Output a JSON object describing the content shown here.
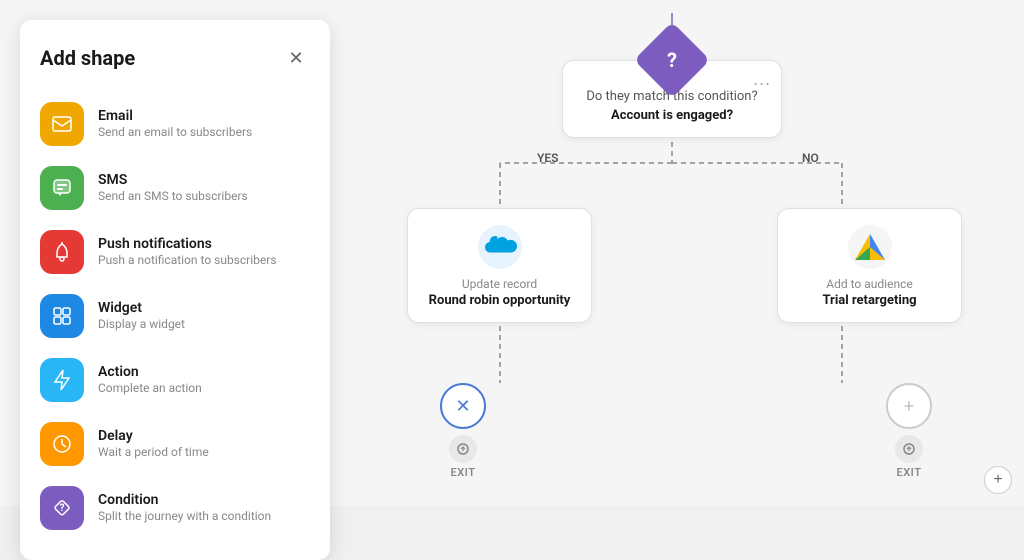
{
  "sidebar": {
    "title": "Add shape",
    "items": [
      {
        "id": "email",
        "name": "Email",
        "desc": "Send an email to subscribers",
        "icon_bg": "#f0a800",
        "icon_symbol": "✉"
      },
      {
        "id": "sms",
        "name": "SMS",
        "desc": "Send an SMS to subscribers",
        "icon_bg": "#4caf50",
        "icon_symbol": "💬"
      },
      {
        "id": "push",
        "name": "Push notifications",
        "desc": "Push a notification to subscribers",
        "icon_bg": "#e53935",
        "icon_symbol": "🔔"
      },
      {
        "id": "widget",
        "name": "Widget",
        "desc": "Display a widget",
        "icon_bg": "#1e88e5",
        "icon_symbol": "⬛"
      },
      {
        "id": "action",
        "name": "Action",
        "desc": "Complete an action",
        "icon_bg": "#29b6f6",
        "icon_symbol": "⚡"
      },
      {
        "id": "delay",
        "name": "Delay",
        "desc": "Wait a period of time",
        "icon_bg": "#ff9800",
        "icon_symbol": "⏱"
      },
      {
        "id": "condition",
        "name": "Condition",
        "desc": "Split the journey with a condition",
        "icon_bg": "#7c5cbf",
        "icon_symbol": "?"
      }
    ]
  },
  "flow": {
    "condition_card": {
      "question": "Do they match this condition?",
      "answer": "Account is engaged?",
      "more": "..."
    },
    "yes_label": "YES",
    "no_label": "NO",
    "left_node": {
      "sub": "Update record",
      "title": "Round robin opportunity"
    },
    "right_node": {
      "sub": "Add to audience",
      "title": "Trial retargeting"
    },
    "exit_label": "EXIT",
    "add_btn": "+"
  }
}
